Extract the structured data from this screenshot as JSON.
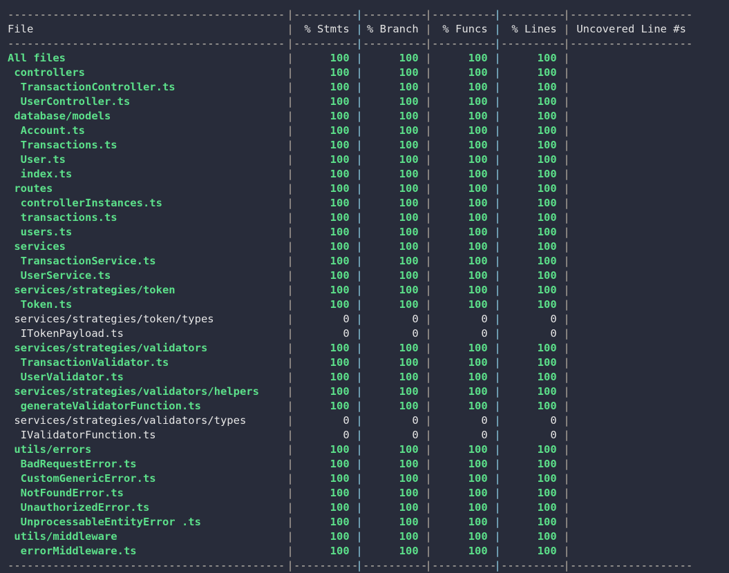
{
  "terminal": {
    "background_color": "#282c3a",
    "pipe_color": "#b6ada0",
    "pass_color": "#5ce08a",
    "zero_color": "#e6e6e6",
    "header_color": "#e3e3e3",
    "rule_color": "#c9c2b6",
    "pipe_char": "|",
    "rule_file": "-------------------------------------------",
    "rule_num": "----------",
    "rule_unc": "-------------------"
  },
  "table": {
    "columns": [
      {
        "key": "file",
        "label": "File",
        "align": "left"
      },
      {
        "key": "stmts",
        "label": "% Stmts",
        "align": "right"
      },
      {
        "key": "branch",
        "label": "% Branch",
        "align": "right"
      },
      {
        "key": "funcs",
        "label": "% Funcs",
        "align": "right"
      },
      {
        "key": "lines",
        "label": "% Lines",
        "align": "right"
      },
      {
        "key": "uncovered",
        "label": "Uncovered Line #s",
        "align": "left"
      }
    ],
    "rows": [
      {
        "indent": 0,
        "file": "All files",
        "stmts": "100",
        "branch": "100",
        "funcs": "100",
        "lines": "100",
        "uncovered": "",
        "state": "ok"
      },
      {
        "indent": 1,
        "file": "controllers",
        "stmts": "100",
        "branch": "100",
        "funcs": "100",
        "lines": "100",
        "uncovered": "",
        "state": "ok"
      },
      {
        "indent": 2,
        "file": "TransactionController.ts",
        "stmts": "100",
        "branch": "100",
        "funcs": "100",
        "lines": "100",
        "uncovered": "",
        "state": "ok"
      },
      {
        "indent": 2,
        "file": "UserController.ts",
        "stmts": "100",
        "branch": "100",
        "funcs": "100",
        "lines": "100",
        "uncovered": "",
        "state": "ok"
      },
      {
        "indent": 1,
        "file": "database/models",
        "stmts": "100",
        "branch": "100",
        "funcs": "100",
        "lines": "100",
        "uncovered": "",
        "state": "ok"
      },
      {
        "indent": 2,
        "file": "Account.ts",
        "stmts": "100",
        "branch": "100",
        "funcs": "100",
        "lines": "100",
        "uncovered": "",
        "state": "ok"
      },
      {
        "indent": 2,
        "file": "Transactions.ts",
        "stmts": "100",
        "branch": "100",
        "funcs": "100",
        "lines": "100",
        "uncovered": "",
        "state": "ok"
      },
      {
        "indent": 2,
        "file": "User.ts",
        "stmts": "100",
        "branch": "100",
        "funcs": "100",
        "lines": "100",
        "uncovered": "",
        "state": "ok"
      },
      {
        "indent": 2,
        "file": "index.ts",
        "stmts": "100",
        "branch": "100",
        "funcs": "100",
        "lines": "100",
        "uncovered": "",
        "state": "ok"
      },
      {
        "indent": 1,
        "file": "routes",
        "stmts": "100",
        "branch": "100",
        "funcs": "100",
        "lines": "100",
        "uncovered": "",
        "state": "ok"
      },
      {
        "indent": 2,
        "file": "controllerInstances.ts",
        "stmts": "100",
        "branch": "100",
        "funcs": "100",
        "lines": "100",
        "uncovered": "",
        "state": "ok"
      },
      {
        "indent": 2,
        "file": "transactions.ts",
        "stmts": "100",
        "branch": "100",
        "funcs": "100",
        "lines": "100",
        "uncovered": "",
        "state": "ok"
      },
      {
        "indent": 2,
        "file": "users.ts",
        "stmts": "100",
        "branch": "100",
        "funcs": "100",
        "lines": "100",
        "uncovered": "",
        "state": "ok"
      },
      {
        "indent": 1,
        "file": "services",
        "stmts": "100",
        "branch": "100",
        "funcs": "100",
        "lines": "100",
        "uncovered": "",
        "state": "ok"
      },
      {
        "indent": 2,
        "file": "TransactionService.ts",
        "stmts": "100",
        "branch": "100",
        "funcs": "100",
        "lines": "100",
        "uncovered": "",
        "state": "ok"
      },
      {
        "indent": 2,
        "file": "UserService.ts",
        "stmts": "100",
        "branch": "100",
        "funcs": "100",
        "lines": "100",
        "uncovered": "",
        "state": "ok"
      },
      {
        "indent": 1,
        "file": "services/strategies/token",
        "stmts": "100",
        "branch": "100",
        "funcs": "100",
        "lines": "100",
        "uncovered": "",
        "state": "ok"
      },
      {
        "indent": 2,
        "file": "Token.ts",
        "stmts": "100",
        "branch": "100",
        "funcs": "100",
        "lines": "100",
        "uncovered": "",
        "state": "ok"
      },
      {
        "indent": 1,
        "file": "services/strategies/token/types",
        "stmts": "0",
        "branch": "0",
        "funcs": "0",
        "lines": "0",
        "uncovered": "",
        "state": "zero"
      },
      {
        "indent": 2,
        "file": "ITokenPayload.ts",
        "stmts": "0",
        "branch": "0",
        "funcs": "0",
        "lines": "0",
        "uncovered": "",
        "state": "zero"
      },
      {
        "indent": 1,
        "file": "services/strategies/validators",
        "stmts": "100",
        "branch": "100",
        "funcs": "100",
        "lines": "100",
        "uncovered": "",
        "state": "ok"
      },
      {
        "indent": 2,
        "file": "TransactionValidator.ts",
        "stmts": "100",
        "branch": "100",
        "funcs": "100",
        "lines": "100",
        "uncovered": "",
        "state": "ok"
      },
      {
        "indent": 2,
        "file": "UserValidator.ts",
        "stmts": "100",
        "branch": "100",
        "funcs": "100",
        "lines": "100",
        "uncovered": "",
        "state": "ok"
      },
      {
        "indent": 1,
        "file": "services/strategies/validators/helpers",
        "stmts": "100",
        "branch": "100",
        "funcs": "100",
        "lines": "100",
        "uncovered": "",
        "state": "ok"
      },
      {
        "indent": 2,
        "file": "generateValidatorFunction.ts",
        "stmts": "100",
        "branch": "100",
        "funcs": "100",
        "lines": "100",
        "uncovered": "",
        "state": "ok"
      },
      {
        "indent": 1,
        "file": "services/strategies/validators/types",
        "stmts": "0",
        "branch": "0",
        "funcs": "0",
        "lines": "0",
        "uncovered": "",
        "state": "zero"
      },
      {
        "indent": 2,
        "file": "IValidatorFunction.ts",
        "stmts": "0",
        "branch": "0",
        "funcs": "0",
        "lines": "0",
        "uncovered": "",
        "state": "zero"
      },
      {
        "indent": 1,
        "file": "utils/errors",
        "stmts": "100",
        "branch": "100",
        "funcs": "100",
        "lines": "100",
        "uncovered": "",
        "state": "ok"
      },
      {
        "indent": 2,
        "file": "BadRequestError.ts",
        "stmts": "100",
        "branch": "100",
        "funcs": "100",
        "lines": "100",
        "uncovered": "",
        "state": "ok"
      },
      {
        "indent": 2,
        "file": "CustomGenericError.ts",
        "stmts": "100",
        "branch": "100",
        "funcs": "100",
        "lines": "100",
        "uncovered": "",
        "state": "ok"
      },
      {
        "indent": 2,
        "file": "NotFoundError.ts",
        "stmts": "100",
        "branch": "100",
        "funcs": "100",
        "lines": "100",
        "uncovered": "",
        "state": "ok"
      },
      {
        "indent": 2,
        "file": "UnauthorizedError.ts",
        "stmts": "100",
        "branch": "100",
        "funcs": "100",
        "lines": "100",
        "uncovered": "",
        "state": "ok"
      },
      {
        "indent": 2,
        "file": "UnprocessableEntityError .ts",
        "stmts": "100",
        "branch": "100",
        "funcs": "100",
        "lines": "100",
        "uncovered": "",
        "state": "ok"
      },
      {
        "indent": 1,
        "file": "utils/middleware",
        "stmts": "100",
        "branch": "100",
        "funcs": "100",
        "lines": "100",
        "uncovered": "",
        "state": "ok"
      },
      {
        "indent": 2,
        "file": "errorMiddleware.ts",
        "stmts": "100",
        "branch": "100",
        "funcs": "100",
        "lines": "100",
        "uncovered": "",
        "state": "ok"
      }
    ]
  }
}
